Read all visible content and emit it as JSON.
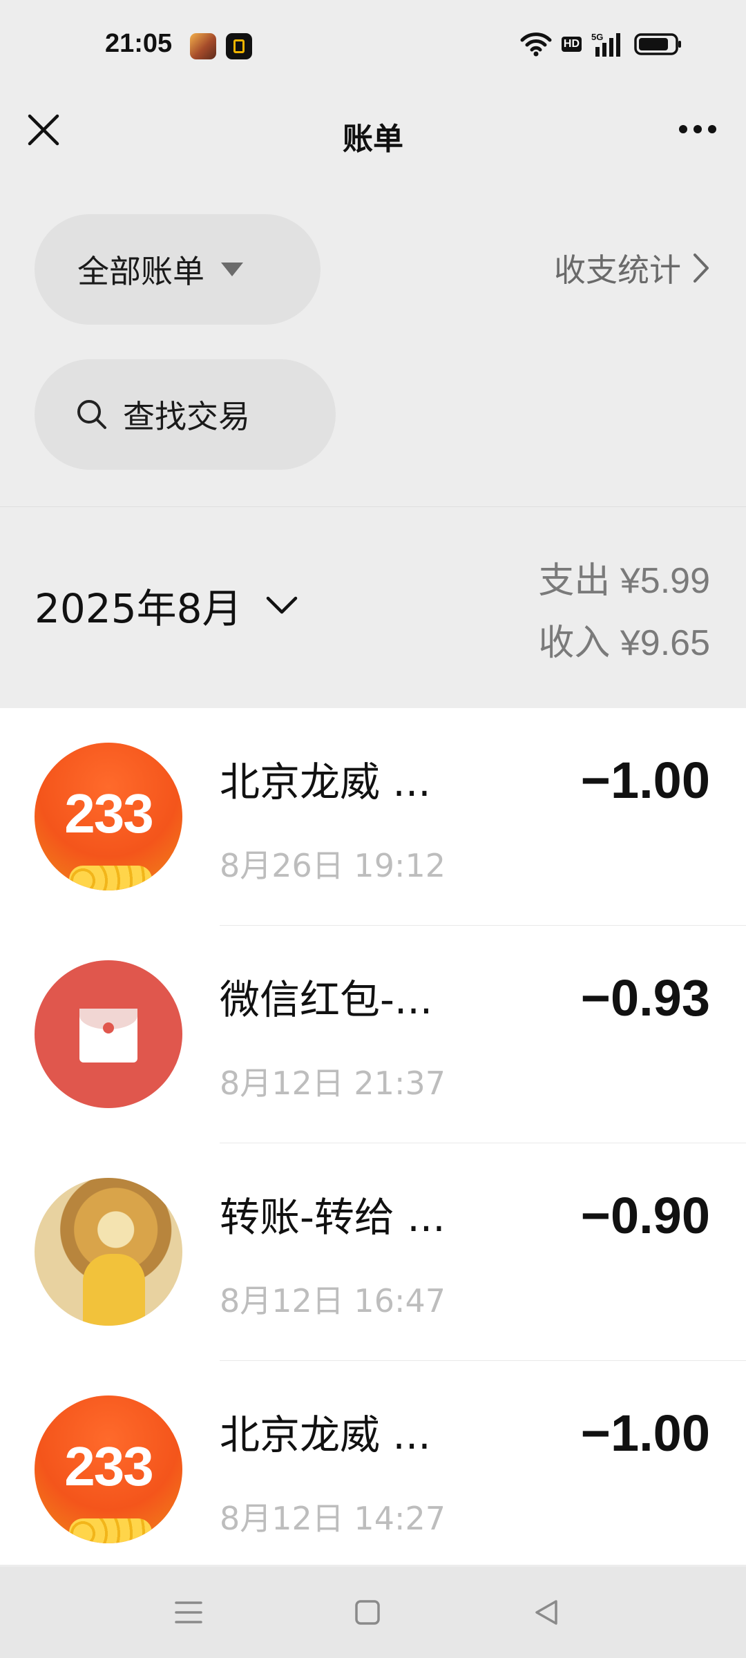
{
  "status_bar": {
    "time": "21:05",
    "hd_label": "HD",
    "network_label": "5G"
  },
  "header": {
    "title": "账单"
  },
  "filter": {
    "label": "全部账单",
    "stats_label": "收支统计"
  },
  "search": {
    "placeholder": "查找交易"
  },
  "month": {
    "label": "2025年8月",
    "expense": "支出 ¥5.99",
    "income": "收入 ¥9.65"
  },
  "transactions": [
    {
      "title": "北京龙威 ...",
      "time": "8月26日 19:12",
      "amount": "−1.00",
      "avatar_text": "233"
    },
    {
      "title": "微信红包-...",
      "time": "8月12日 21:37",
      "amount": "−0.93"
    },
    {
      "title": "转账-转给 ...",
      "time": "8月12日 16:47",
      "amount": "−0.90"
    },
    {
      "title": "北京龙威 ...",
      "time": "8月12日 14:27",
      "amount": "−1.00",
      "avatar_text": "233"
    }
  ],
  "icons": {
    "close": "close-icon",
    "more": "more-icon",
    "caret": "caret-down-icon",
    "chevron": "chevron-right-icon",
    "search": "search-icon",
    "month_chevron": "chevron-down-icon",
    "nav_menu": "menu-icon",
    "nav_home": "home-icon",
    "nav_back": "back-icon"
  }
}
